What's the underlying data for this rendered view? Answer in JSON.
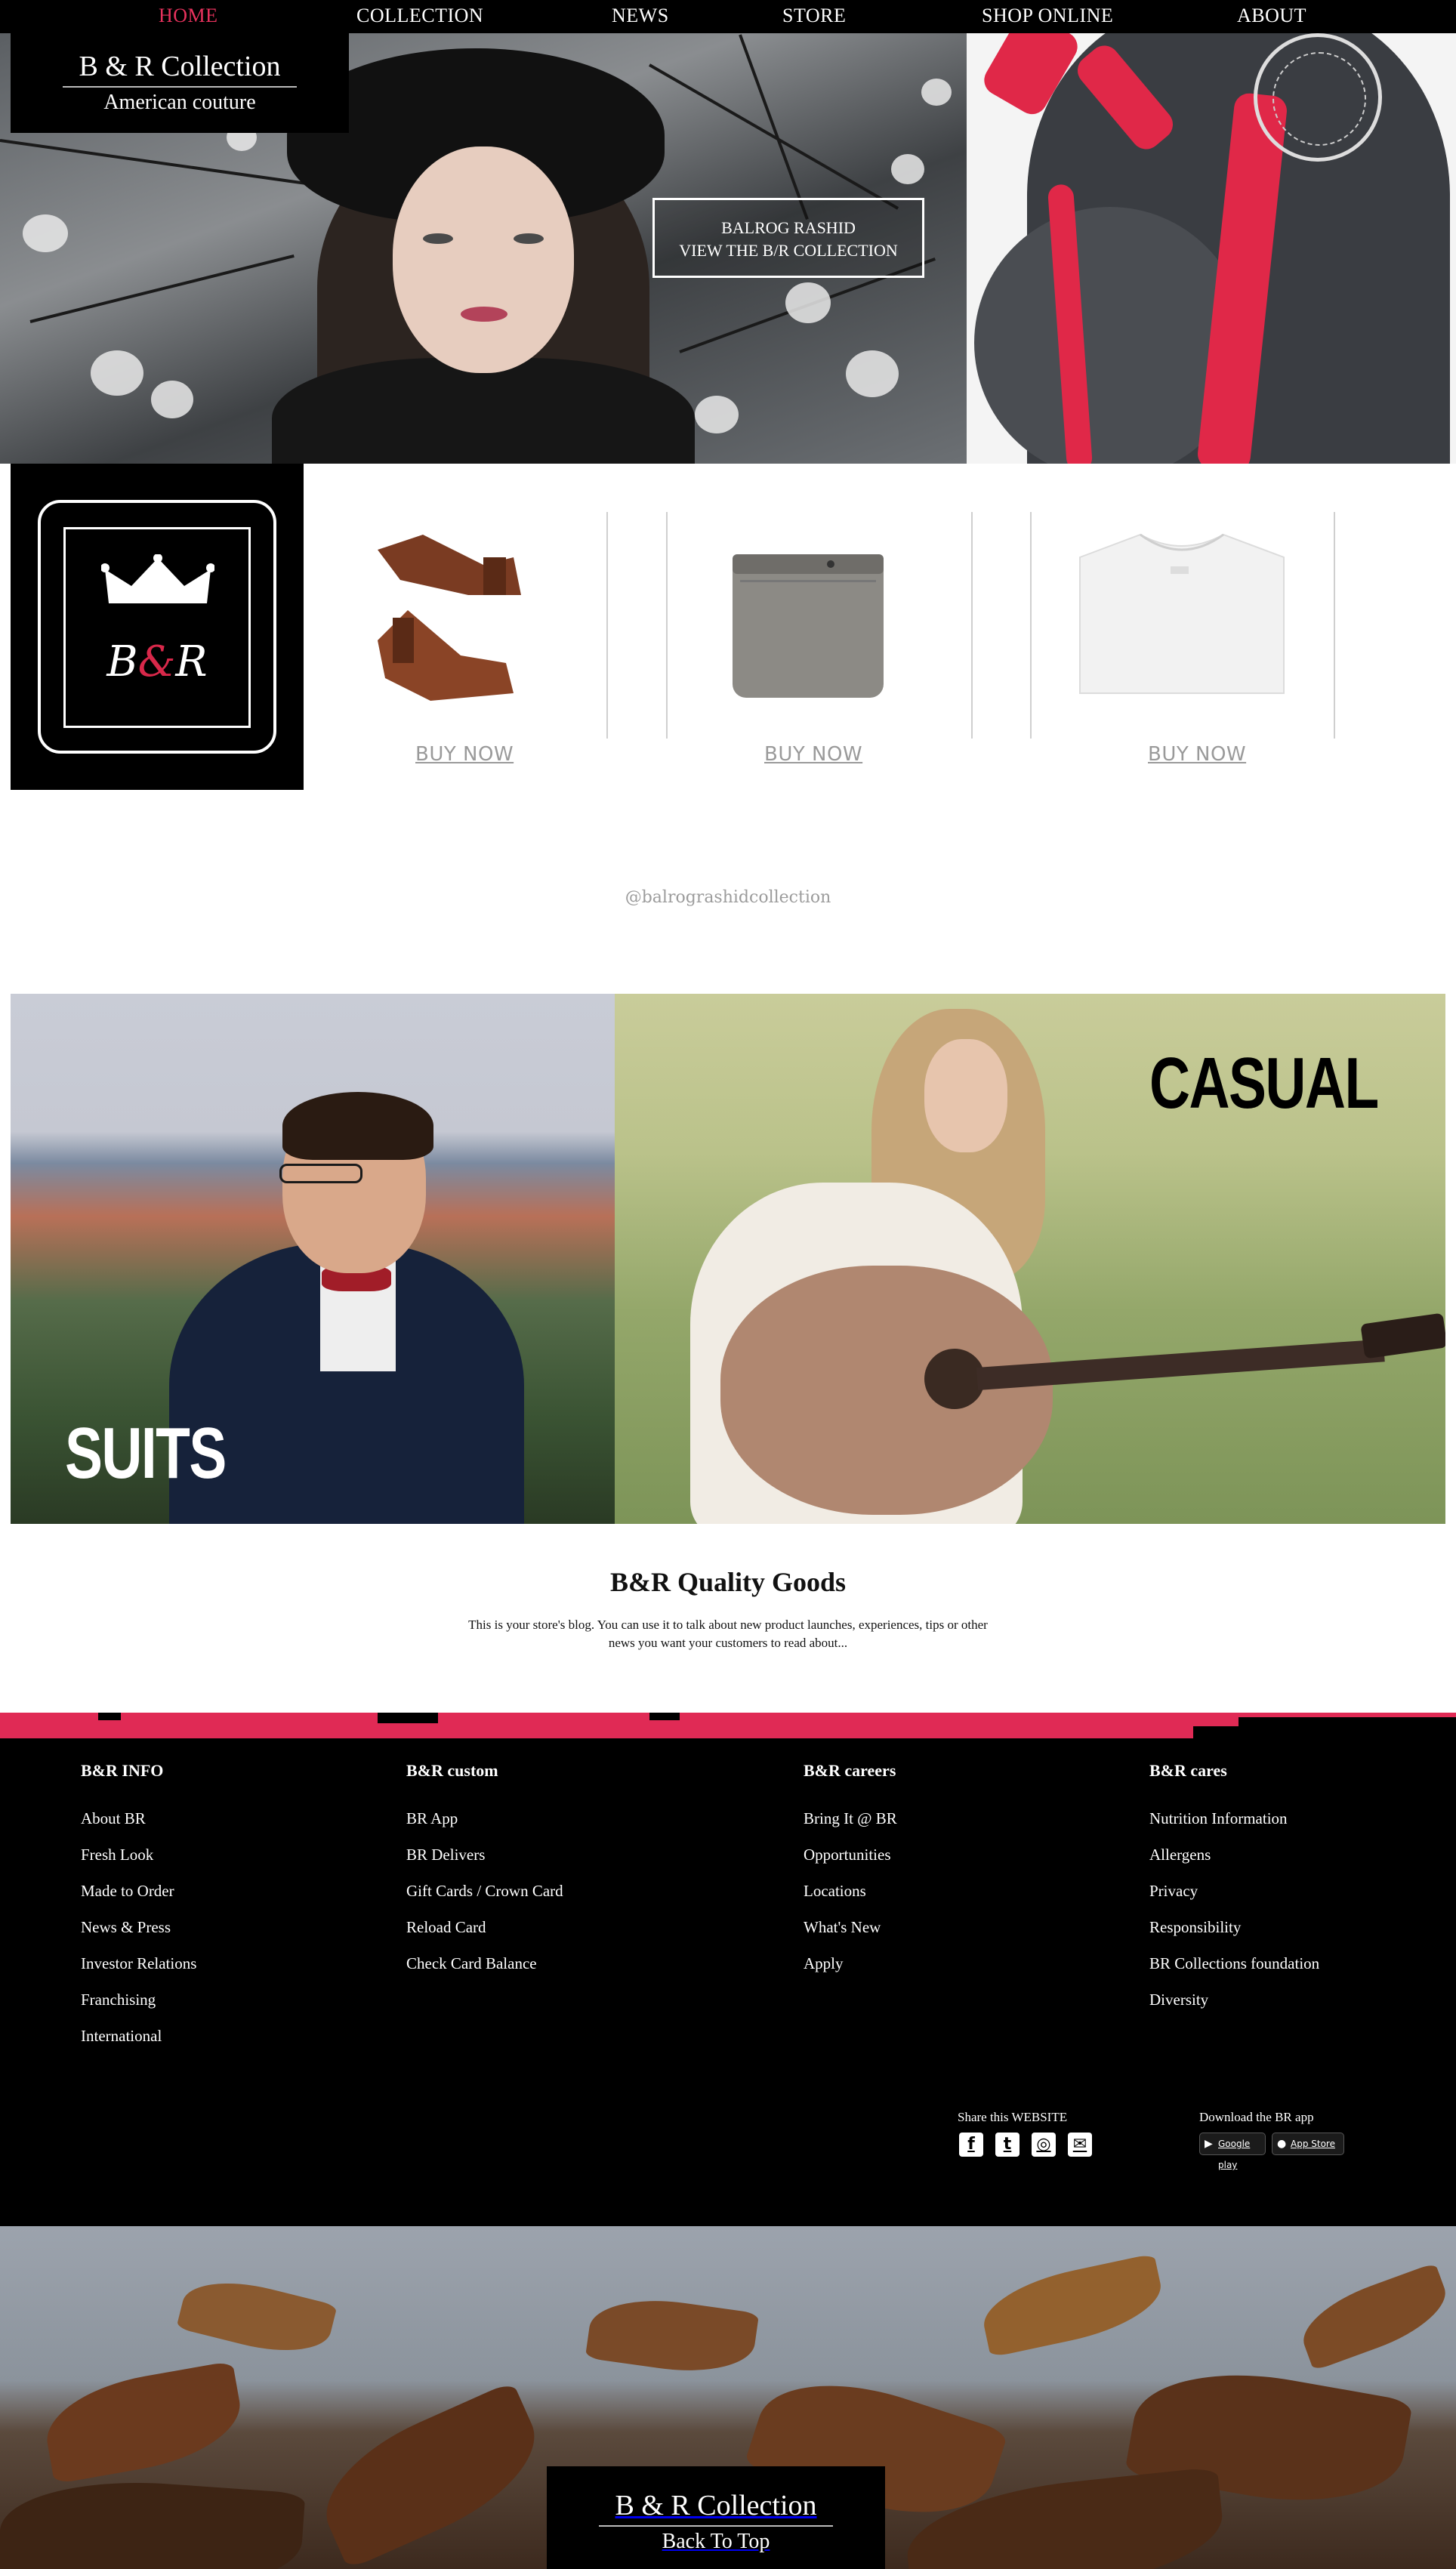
{
  "nav": {
    "items": [
      {
        "label": "HOME",
        "active": true
      },
      {
        "label": "COLLECTION",
        "active": false
      },
      {
        "label": "NEWS",
        "active": false
      },
      {
        "label": "STORE",
        "active": false
      },
      {
        "label": "SHOP ONLINE",
        "active": false
      },
      {
        "label": "ABOUT",
        "active": false
      }
    ]
  },
  "brand": {
    "title": "B & R Collection",
    "subtitle": "American couture"
  },
  "hero": {
    "cta_line1": "BALROG RASHID",
    "cta_line2": "VIEW THE B/R COLLECTION"
  },
  "logo": {
    "monogram_left": "B",
    "monogram_amp": "&",
    "monogram_right": "R"
  },
  "products": [
    {
      "name": "boots",
      "buy_label": "BUY NOW"
    },
    {
      "name": "trousers",
      "buy_label": "BUY NOW"
    },
    {
      "name": "t-shirt",
      "buy_label": "BUY NOW"
    }
  ],
  "social_handle": "@balrograshidcollection",
  "collections": {
    "suits_label": "SUITS",
    "casual_label": "CASUAL"
  },
  "blog": {
    "title": "B&R Quality Goods",
    "text": "This is your store's blog. You can use it to talk about new product launches, experiences, tips or other news you want your customers to read about..."
  },
  "footer": {
    "columns": [
      {
        "heading": "B&R INFO",
        "links": [
          "About BR",
          "Fresh Look",
          "Made to Order",
          "News & Press",
          "Investor Relations",
          "Franchising",
          "International"
        ]
      },
      {
        "heading": "B&R custom",
        "links": [
          "BR App",
          "BR Delivers",
          "Gift Cards / Crown Card",
          "Reload Card",
          "Check Card Balance"
        ]
      },
      {
        "heading": "B&R careers",
        "links": [
          "Bring It @ BR",
          "Opportunities",
          "Locations",
          "What's New",
          "Apply"
        ]
      },
      {
        "heading": "B&R cares",
        "links": [
          "Nutrition Information",
          "Allergens",
          "Privacy",
          "Responsibility",
          "BR Collections foundation",
          "Diversity"
        ]
      }
    ],
    "share_label": "Share this WEBSITE",
    "app_label": "Download the BR app",
    "social_icons": [
      "facebook-icon",
      "twitter-icon",
      "instagram-icon",
      "mail-icon"
    ],
    "google_play": "Google play",
    "app_store": "App Store"
  },
  "back_to_top": {
    "title": "B & R Collection",
    "label": "Back To Top"
  },
  "colors": {
    "accent": "#e8325d",
    "black": "#000000",
    "paint_red": "#e02a55"
  }
}
